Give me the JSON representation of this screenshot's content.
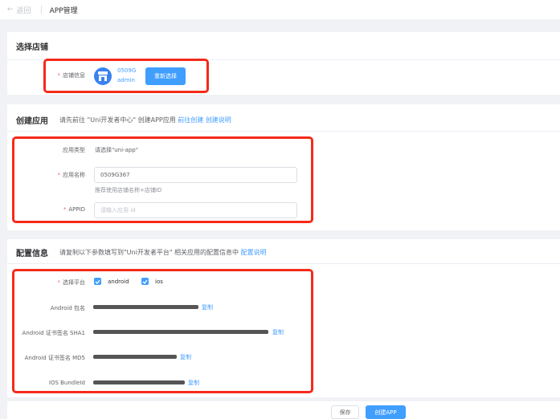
{
  "header": {
    "back_label": "返回",
    "title": "APP管理"
  },
  "store_section": {
    "title": "选择店铺",
    "label": "店铺信息",
    "store_name": "0509G",
    "store_user": "admin",
    "reselect_label": "重新选择"
  },
  "create_section": {
    "title": "创建应用",
    "desc": "请先前往 \"Uni开发者中心\" 创建APP应用",
    "link_create": "前往创建",
    "link_help": "创建说明",
    "type_label": "应用类型",
    "type_value": "请选择\"uni-app\"",
    "name_label": "应用名称",
    "name_value": "0509G367",
    "name_hint": "推荐使用店铺名称+店铺ID",
    "appid_label": "APPID",
    "appid_placeholder": "请输入应用 id"
  },
  "config_section": {
    "title": "配置信息",
    "desc": "请复制以下参数填写到\"Uni开发者平台\" 相关应用的配置信息中",
    "link_help": "配置说明",
    "platform_label": "选择平台",
    "platforms": [
      "android",
      "ios"
    ],
    "rows": [
      {
        "label": "Android 包名",
        "copy": "复制"
      },
      {
        "label": "Android 证书签名 SHA1",
        "copy": "复制"
      },
      {
        "label": "Android 证书签名 MD5",
        "copy": "复制"
      },
      {
        "label": "IOS BundleId",
        "copy": "复制"
      }
    ]
  },
  "footer": {
    "save_label": "保存",
    "create_label": "创建APP"
  },
  "colors": {
    "primary": "#409eff",
    "highlight": "#f52a1a",
    "required": "#f56c6c"
  }
}
